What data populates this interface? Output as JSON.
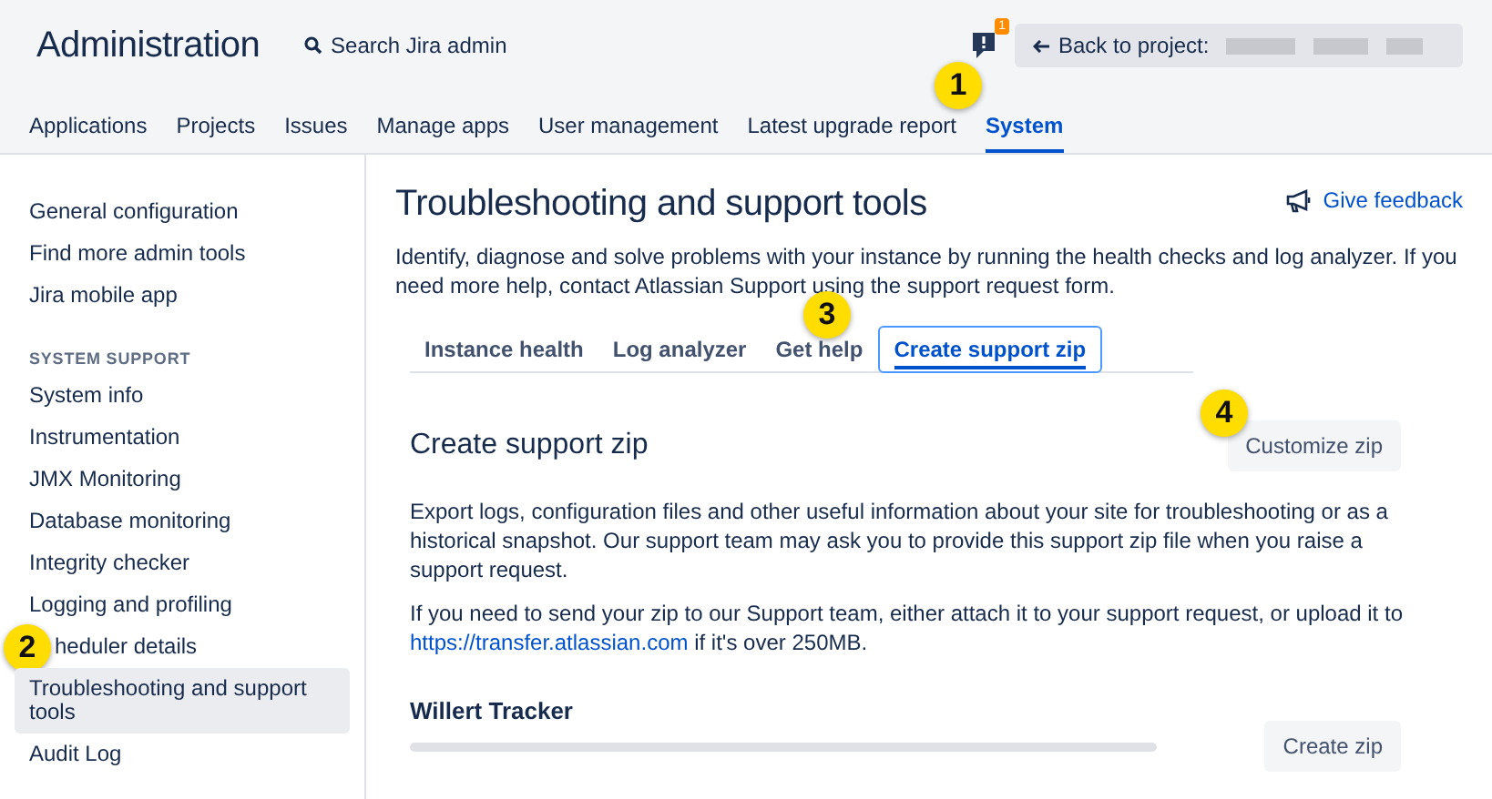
{
  "header": {
    "title": "Administration",
    "search": {
      "placeholder": "Search Jira admin"
    },
    "notification_count": "1",
    "back_button": "Back to project:"
  },
  "nav": [
    {
      "label": "Applications",
      "selected": false
    },
    {
      "label": "Projects",
      "selected": false
    },
    {
      "label": "Issues",
      "selected": false
    },
    {
      "label": "Manage apps",
      "selected": false
    },
    {
      "label": "User management",
      "selected": false
    },
    {
      "label": "Latest upgrade report",
      "selected": false
    },
    {
      "label": "System",
      "selected": true
    }
  ],
  "sidebar": {
    "groups": [
      {
        "items": [
          {
            "label": "General configuration",
            "selected": false
          },
          {
            "label": "Find more admin tools",
            "selected": false
          },
          {
            "label": "Jira mobile app",
            "selected": false
          }
        ]
      },
      {
        "heading": "SYSTEM SUPPORT",
        "items": [
          {
            "label": "System info",
            "selected": false
          },
          {
            "label": "Instrumentation",
            "selected": false
          },
          {
            "label": "JMX Monitoring",
            "selected": false
          },
          {
            "label": "Database monitoring",
            "selected": false
          },
          {
            "label": "Integrity checker",
            "selected": false
          },
          {
            "label": "Logging and profiling",
            "selected": false
          },
          {
            "label": "heduler details",
            "selected": false,
            "callout": "2"
          },
          {
            "label": "Troubleshooting and support tools",
            "selected": true
          },
          {
            "label": "Audit Log",
            "selected": false
          }
        ]
      }
    ]
  },
  "main": {
    "title": "Troubleshooting and support tools",
    "feedback_link": "Give feedback",
    "intro": "Identify, diagnose and solve problems with your instance by running the health checks and log analyzer. If you need more help, contact Atlassian Support using the support request form.",
    "tabs": [
      {
        "label": "Instance health",
        "selected": false
      },
      {
        "label": "Log analyzer",
        "selected": false
      },
      {
        "label": "Get help",
        "selected": false
      },
      {
        "label": "Create support zip",
        "selected": true
      }
    ],
    "section_title": "Create support zip",
    "customize_button": "Customize zip",
    "paragraph_1": "Export logs, configuration files and other useful information about your site for troubleshooting or as a historical snapshot. Our support team may ask you to provide this support zip file when you raise a support request.",
    "paragraph_2_before": "If you need to send your zip to our Support team, either attach it to your support request, or upload it to",
    "paragraph_2_link": "https://transfer.atlassian.com",
    "paragraph_2_after": "if it's over 250MB.",
    "node": {
      "name": "Willert Tracker",
      "button": "Create zip"
    }
  },
  "callouts": [
    "1",
    "3",
    "4"
  ]
}
